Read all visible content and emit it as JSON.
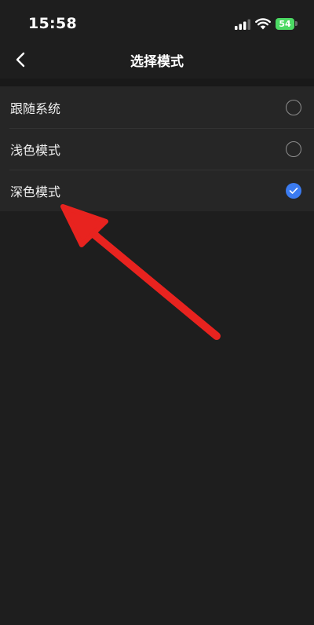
{
  "status_bar": {
    "time": "15:58",
    "battery_level": "54",
    "signal_icon": "cellular-signal-icon",
    "wifi_icon": "wifi-icon",
    "battery_color": "#4cd964"
  },
  "nav": {
    "title": "选择模式",
    "back_icon": "chevron-left-icon"
  },
  "options": [
    {
      "label": "跟随系统",
      "selected": false
    },
    {
      "label": "浅色模式",
      "selected": false
    },
    {
      "label": "深色模式",
      "selected": true
    }
  ],
  "colors": {
    "background": "#1e1e1e",
    "list_background": "#262626",
    "accent": "#3b7bf0",
    "annotation_arrow": "#e8231f"
  }
}
